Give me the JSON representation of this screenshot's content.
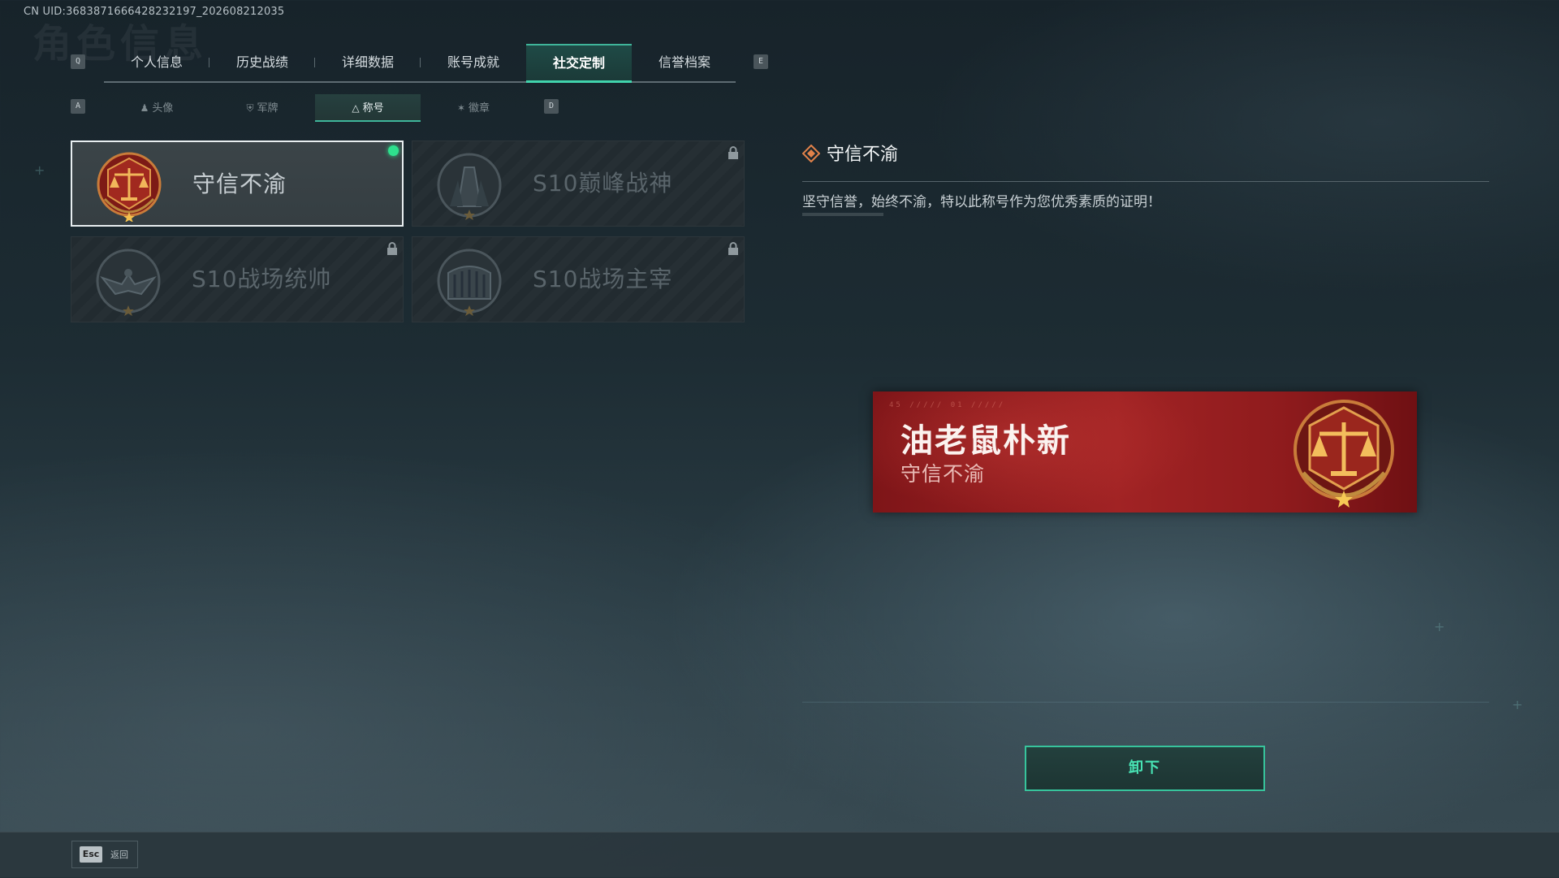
{
  "uid_text": "CN UID:3683871666428232197_202608212035",
  "ghost_title": "角色信息",
  "tabs": {
    "prev_key": "Q",
    "next_key": "E",
    "items": [
      {
        "label": "个人信息"
      },
      {
        "label": "历史战绩"
      },
      {
        "label": "详细数据"
      },
      {
        "label": "账号成就"
      },
      {
        "label": "社交定制",
        "active": true
      },
      {
        "label": "信誉档案"
      }
    ]
  },
  "subtabs": {
    "prev_key": "A",
    "next_key": "D",
    "items": [
      {
        "label": "头像",
        "icon": "person-icon"
      },
      {
        "label": "军牌",
        "icon": "dogtag-icon"
      },
      {
        "label": "称号",
        "icon": "title-icon",
        "active": true
      },
      {
        "label": "徽章",
        "icon": "emblem-icon"
      }
    ]
  },
  "titles": [
    {
      "name": "守信不渝",
      "selected": true,
      "equipped": true,
      "locked": false,
      "badge": "scales-badge"
    },
    {
      "name": "S10巅峰战神",
      "selected": false,
      "locked": true,
      "badge": "tower-badge"
    },
    {
      "name": "S10战场统帅",
      "selected": false,
      "locked": true,
      "badge": "eagle-badge"
    },
    {
      "name": "S10战场主宰",
      "selected": false,
      "locked": true,
      "badge": "colosseum-badge"
    }
  ],
  "detail": {
    "title": "守信不渝",
    "description": "坚守信誉，始终不渝，特以此称号作为您优秀素质的证明！"
  },
  "nameplate": {
    "player_name": "油老鼠朴新",
    "title": "守信不渝",
    "background_color": "#a12324"
  },
  "action_button": "卸下",
  "footer": {
    "esc_key": "Esc",
    "esc_label": "返回"
  },
  "colors": {
    "accent": "#41d3ac",
    "equipped_dot": "#2ee08d",
    "nameplate_red": "#a12324"
  }
}
